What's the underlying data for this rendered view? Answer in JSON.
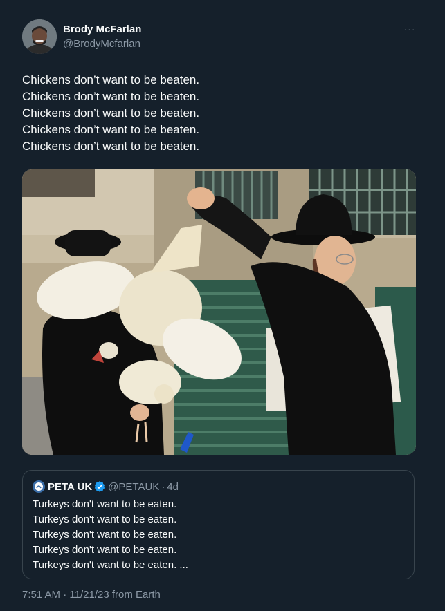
{
  "author": {
    "name": "Brody McFarlan",
    "handle": "@BrodyMcfarlan"
  },
  "more_label": "···",
  "tweet": {
    "lines": [
      "Chickens don’t want to be beaten.",
      "Chickens don’t want to be beaten.",
      "Chickens don’t want to be beaten.",
      "Chickens don’t want to be beaten.",
      "Chickens don’t want to be beaten."
    ]
  },
  "quote": {
    "name": "PETA UK",
    "handle": "@PETAUK",
    "separator": "·",
    "time": "4d",
    "lines": [
      "Turkeys don't want to be eaten.",
      "Turkeys don't want to be eaten.",
      "Turkeys don't want to be eaten.",
      "Turkeys don't want to be eaten.",
      "Turkeys don't want to be eaten. ..."
    ]
  },
  "meta": {
    "time": "7:51 AM",
    "separator": "·",
    "date": "11/21/23",
    "source": "from Earth"
  },
  "colors": {
    "background": "#15202b",
    "verified": "#1d9bf0",
    "secondary_text": "#8b98a5",
    "border": "#38444d"
  }
}
